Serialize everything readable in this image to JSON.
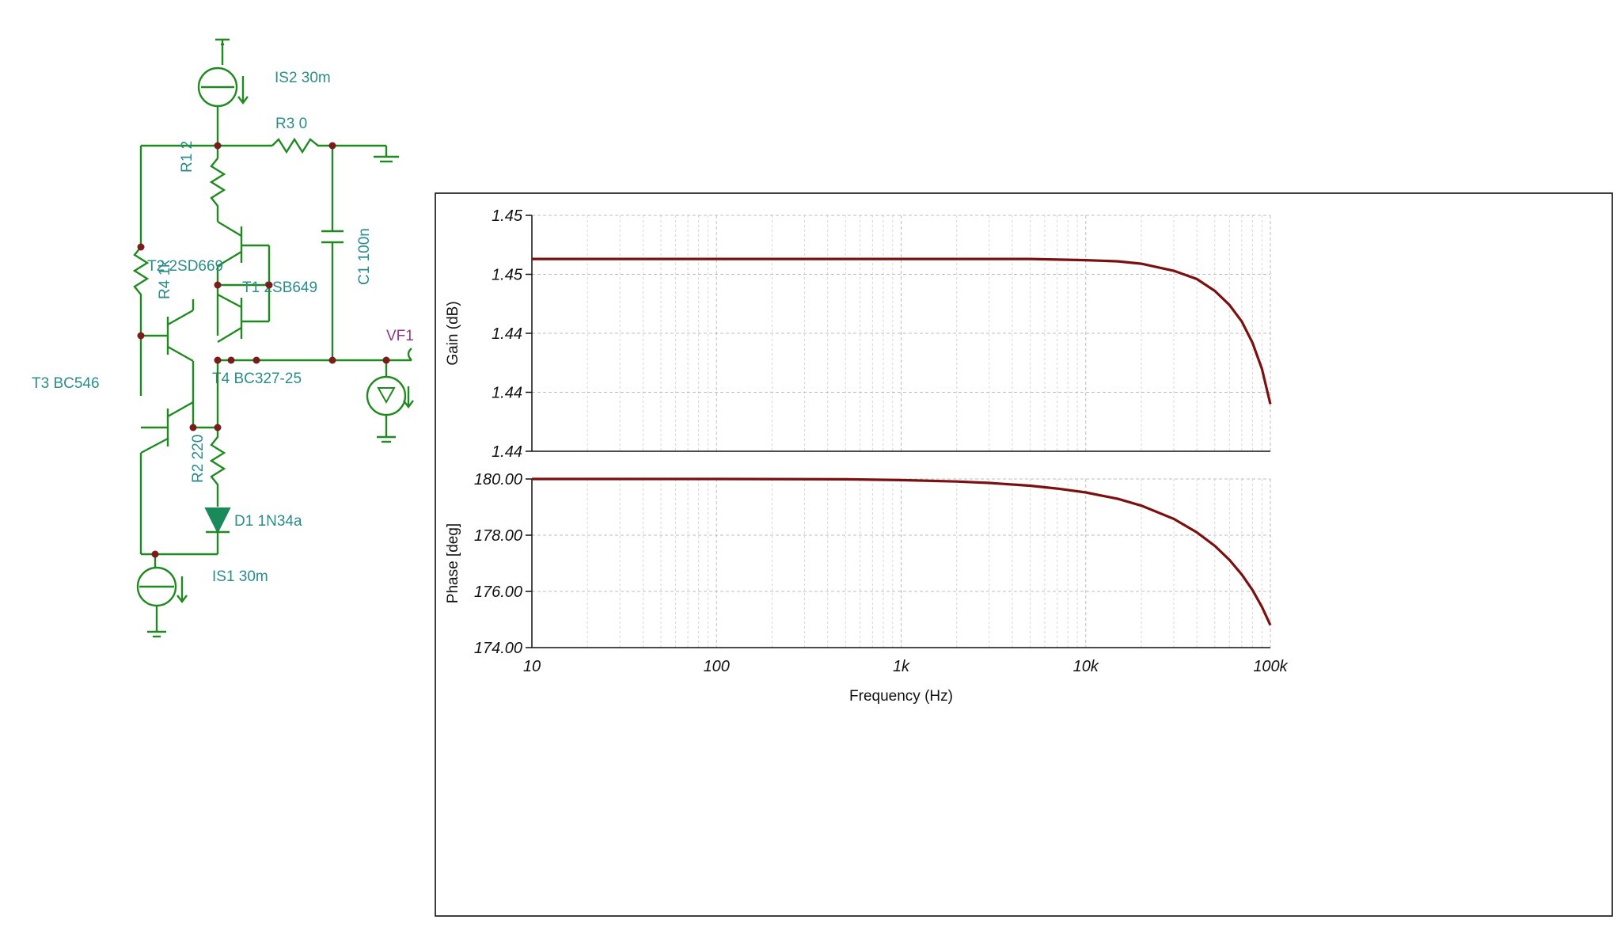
{
  "schematic": {
    "labels": {
      "is2": "IS2 30m",
      "r3": "R3 0",
      "r1": "R1 2",
      "c1": "C1 100n",
      "t2": "T2 2SD669",
      "r4": "R4 1k",
      "t1": "T1 2SB649",
      "vf1": "VF1",
      "t3": "T3 BC546",
      "t4": "T4 BC327-25",
      "r2": "R2 220",
      "d1": "D1 1N34a",
      "is1": "IS1 30m"
    }
  },
  "chart_data": [
    {
      "type": "line",
      "xscale": "log",
      "xlim": [
        10,
        100000
      ],
      "x_ticks": [
        "10",
        "100",
        "1k",
        "10k",
        "100k"
      ],
      "ylabel": "Gain (dB)",
      "y_ticks": [
        "1.45",
        "1.45",
        "1.44",
        "1.44",
        "1.44"
      ],
      "ylim": [
        1.436,
        1.456
      ],
      "series": [
        {
          "color": "#7a1010",
          "x": [
            10,
            100,
            1000,
            5000,
            10000,
            15000,
            20000,
            30000,
            40000,
            50000,
            60000,
            70000,
            80000,
            90000,
            100000
          ],
          "y": [
            1.4523,
            1.4523,
            1.4523,
            1.4523,
            1.4522,
            1.4521,
            1.4519,
            1.4513,
            1.4506,
            1.4496,
            1.4484,
            1.447,
            1.4452,
            1.443,
            1.44
          ]
        }
      ]
    },
    {
      "type": "line",
      "xscale": "log",
      "xlim": [
        10,
        100000
      ],
      "x_ticks": [
        "10",
        "100",
        "1k",
        "10k",
        "100k"
      ],
      "xlabel": "Frequency (Hz)",
      "ylabel": "Phase [deg]",
      "y_ticks": [
        "180.00",
        "178.00",
        "176.00",
        "174.00"
      ],
      "ylim": [
        174,
        180
      ],
      "series": [
        {
          "color": "#7a1010",
          "x": [
            10,
            100,
            500,
            1000,
            2000,
            3000,
            5000,
            7000,
            10000,
            15000,
            20000,
            30000,
            40000,
            50000,
            60000,
            70000,
            80000,
            90000,
            100000
          ],
          "y": [
            180.0,
            180.0,
            179.99,
            179.96,
            179.91,
            179.86,
            179.76,
            179.66,
            179.52,
            179.29,
            179.05,
            178.58,
            178.1,
            177.62,
            177.12,
            176.6,
            176.05,
            175.45,
            174.8
          ]
        }
      ]
    }
  ]
}
